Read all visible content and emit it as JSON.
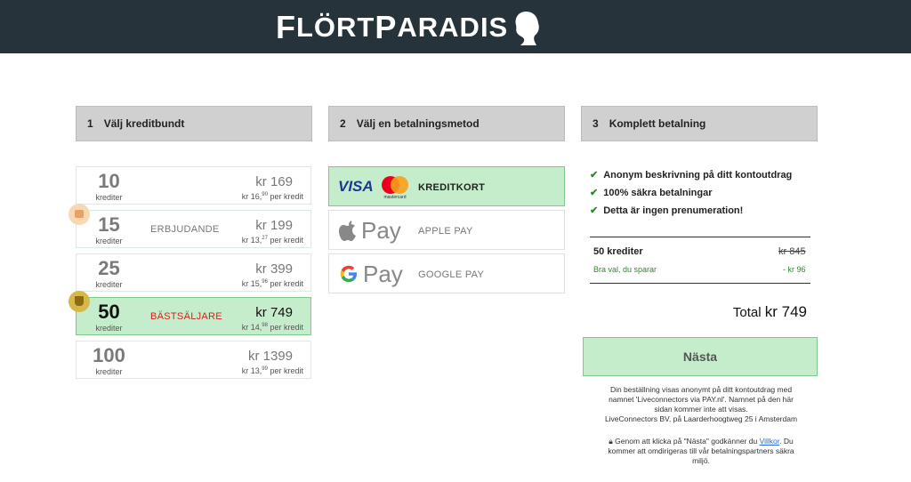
{
  "brand": {
    "logo_first": "F",
    "logo_mid": "LÖRT",
    "logo_p": "P",
    "logo_end": "ARADIS"
  },
  "steps": [
    {
      "num": "1",
      "label": "Välj kreditbundt"
    },
    {
      "num": "2",
      "label": "Välj en betalningsmetod"
    },
    {
      "num": "3",
      "label": "Komplett betalning"
    }
  ],
  "bundles": [
    {
      "count": "10",
      "unit": "krediter",
      "tag": "",
      "price": "kr 169",
      "per_prefix": "kr 16,",
      "per_sup": "90",
      "per_suffix": " per kredit"
    },
    {
      "count": "15",
      "unit": "krediter",
      "tag": "ERBJUDANDE",
      "price": "kr 199",
      "per_prefix": "kr 13,",
      "per_sup": "27",
      "per_suffix": " per kredit"
    },
    {
      "count": "25",
      "unit": "krediter",
      "tag": "",
      "price": "kr 399",
      "per_prefix": "kr 15,",
      "per_sup": "96",
      "per_suffix": " per kredit"
    },
    {
      "count": "50",
      "unit": "krediter",
      "tag": "BÄSTSÄLJARE",
      "price": "kr 749",
      "per_prefix": "kr 14,",
      "per_sup": "98",
      "per_suffix": " per kredit"
    },
    {
      "count": "100",
      "unit": "krediter",
      "tag": "",
      "price": "kr 1399",
      "per_prefix": "kr 13,",
      "per_sup": "99",
      "per_suffix": " per kredit"
    }
  ],
  "payment_methods": [
    {
      "label": "KREDITKORT",
      "logo_visa": "VISA",
      "logo_mc_text": "mastercard",
      "selected": true
    },
    {
      "label": "APPLE PAY",
      "logo_text": "Pay",
      "selected": false
    },
    {
      "label": "GOOGLE PAY",
      "logo_text": "Pay",
      "selected": false
    }
  ],
  "benefits": [
    "Anonym beskrivning på ditt kontoutdrag",
    "100% säkra betalningar",
    "Detta är ingen prenumeration!"
  ],
  "summary": {
    "item": "50 krediter",
    "old_price": "kr 845",
    "save_label": "Bra val, du sparar",
    "save_value": "- kr 96",
    "total_label": "Total",
    "total_amount": "kr 749"
  },
  "next_label": "Nästa",
  "notes": {
    "line1": "Din beställning visas anonymt på ditt kontoutdrag med",
    "line2": "namnet 'Liveconnectors via PAY.nl'. Namnet på den här",
    "line3": "sidan kommer inte att visas.",
    "line4": "LiveConnectors BV, på Laarderhoogtweg 25 i Amsterdam",
    "terms_prefix": "Genom att klicka på \"Nästa\" godkänner du ",
    "terms_link": "Villkor",
    "terms_suffix": ". Du",
    "terms_line2": "kommer att omdirigeras till vår betalningspartners säkra",
    "terms_line3": "miljö."
  },
  "colors": {
    "header": "#26333a",
    "selected": "#c5edcc",
    "accent_red": "#d4221e",
    "check_green": "#2c8a2c"
  }
}
